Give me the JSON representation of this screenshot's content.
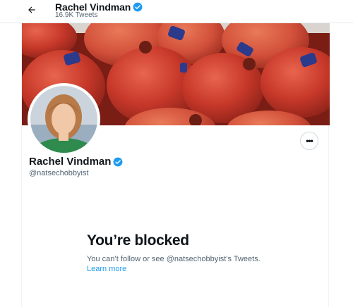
{
  "header": {
    "title": "Rachel Vindman",
    "tweet_count": "16.9K Tweets",
    "back_icon": "arrow-left-icon"
  },
  "profile": {
    "name": "Rachel Vindman",
    "handle": "@natsechobbyist",
    "verified_icon": "verified-badge-icon",
    "more_icon": "more-horizontal-icon"
  },
  "blocked": {
    "title": "You’re blocked",
    "message": "You can’t follow or see @natsechobbyist’s Tweets.",
    "link": "Learn more"
  },
  "colors": {
    "accent": "#1d9bf0",
    "secondary_text": "#536471"
  }
}
